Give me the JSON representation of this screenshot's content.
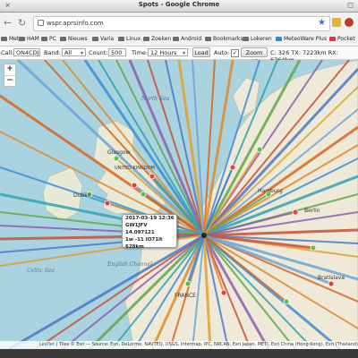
{
  "window": {
    "title": "Spots - Google Chrome"
  },
  "toolbar": {
    "url": "wspr.aprsinfo.com"
  },
  "bookmarks": [
    "Meteo",
    "HAM",
    "PC",
    "Nieuws",
    "Varia",
    "Linux",
    "Zoeken",
    "Android",
    "Bookmarks",
    "Lokeren",
    "MeteoWare Plus",
    "Pocket"
  ],
  "controls": {
    "call_label": "Call:",
    "call_value": "ON4CDJ",
    "band_label": "Band:",
    "band_value": "All",
    "count_label": "Count:",
    "count_value": "500",
    "time_label": "Time:",
    "time_value": "12 Hours",
    "load_button": "Load",
    "auto_label": "Auto:",
    "zoom_button": "Zoom All",
    "stats": "C: 326 TX: 7223km RX: 6764km"
  },
  "map": {
    "zoom_in": "+",
    "zoom_out": "−",
    "popup": {
      "line1": "2017-03-19 12:36",
      "line2": "GW1JFV 14.097121",
      "line3": "1w -11 IO71lt 628km"
    },
    "labels": [
      "North Sea",
      "Celtic Sea",
      "English Channel",
      "Glasgow",
      "Dublin",
      "Hamburg",
      "Berlin",
      "Bratislava",
      "FRANCE",
      "UNITED KINGDOM"
    ],
    "attribution_link": "Leaflet",
    "attribution": "| Tiles © Esri — Source: Esri, DeLorme, NAVTEQ, USGS, Intermap, iPC, NRCAN, Esri Japan, METI, Esri China (Hong Kong), Esri (Thailand)"
  },
  "colors": {
    "sea": "#a9d3df",
    "land": "#efe9d8",
    "accent": "#3a6bd8"
  }
}
